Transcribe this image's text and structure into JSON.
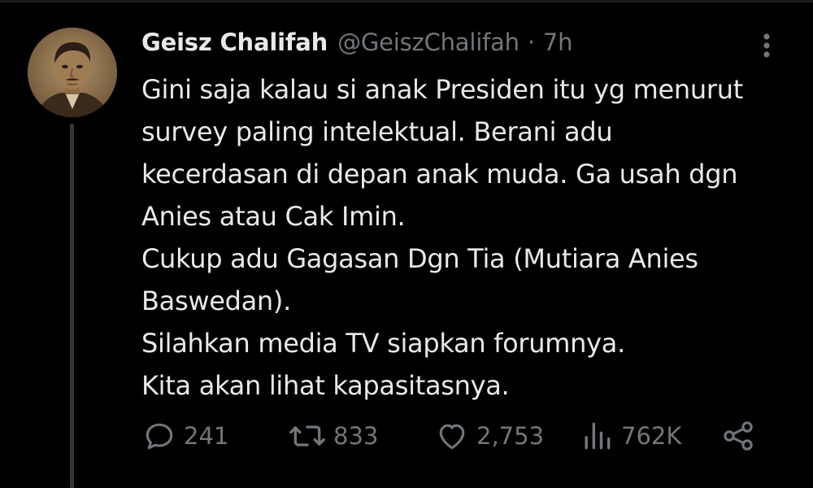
{
  "tweet": {
    "author_name": "Geisz Chalifah",
    "author_handle": "@GeiszChalifah",
    "separator": "·",
    "time": "7h",
    "avatar_icon": "profile-photo",
    "text_lines": [
      "Gini saja kalau si anak Presiden itu yg menurut",
      "survey paling intelektual. Berani adu",
      "kecerdasan di depan anak muda. Ga usah dgn",
      "Anies atau Cak Imin.",
      "Cukup adu Gagasan Dgn Tia (Mutiara Anies",
      "Baswedan).",
      "Silahkan media TV siapkan forumnya.",
      "Kita akan lihat kapasitasnya."
    ]
  },
  "actions": {
    "reply": {
      "icon": "reply-icon",
      "count": "241"
    },
    "retweet": {
      "icon": "retweet-icon",
      "count": "833"
    },
    "like": {
      "icon": "heart-icon",
      "count": "2,753"
    },
    "views": {
      "icon": "views-icon",
      "count": "762K"
    },
    "share": {
      "icon": "share-icon"
    }
  },
  "colors": {
    "background": "#000000",
    "text_primary": "#e7e9ea",
    "text_secondary": "#71767b",
    "thread_line": "#333639"
  }
}
